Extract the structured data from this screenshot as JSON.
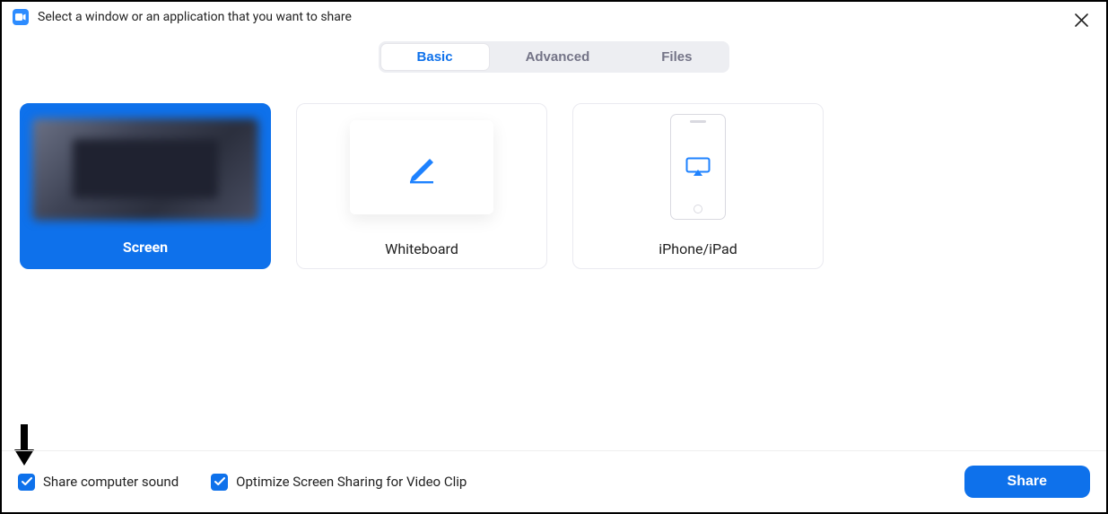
{
  "header": {
    "title": "Select a window or an application that you want to share"
  },
  "tabs": {
    "basic": "Basic",
    "advanced": "Advanced",
    "files": "Files",
    "active": "basic"
  },
  "options": {
    "screen": {
      "label": "Screen",
      "selected": true
    },
    "whiteboard": {
      "label": "Whiteboard",
      "selected": false
    },
    "iphone": {
      "label": "iPhone/iPad",
      "selected": false
    }
  },
  "footer": {
    "share_sound": {
      "label": "Share computer sound",
      "checked": true
    },
    "optimize_video": {
      "label": "Optimize Screen Sharing for Video Clip",
      "checked": true
    },
    "share_button": "Share"
  },
  "colors": {
    "accent": "#0E71EB",
    "tab_inactive": "#747487"
  }
}
